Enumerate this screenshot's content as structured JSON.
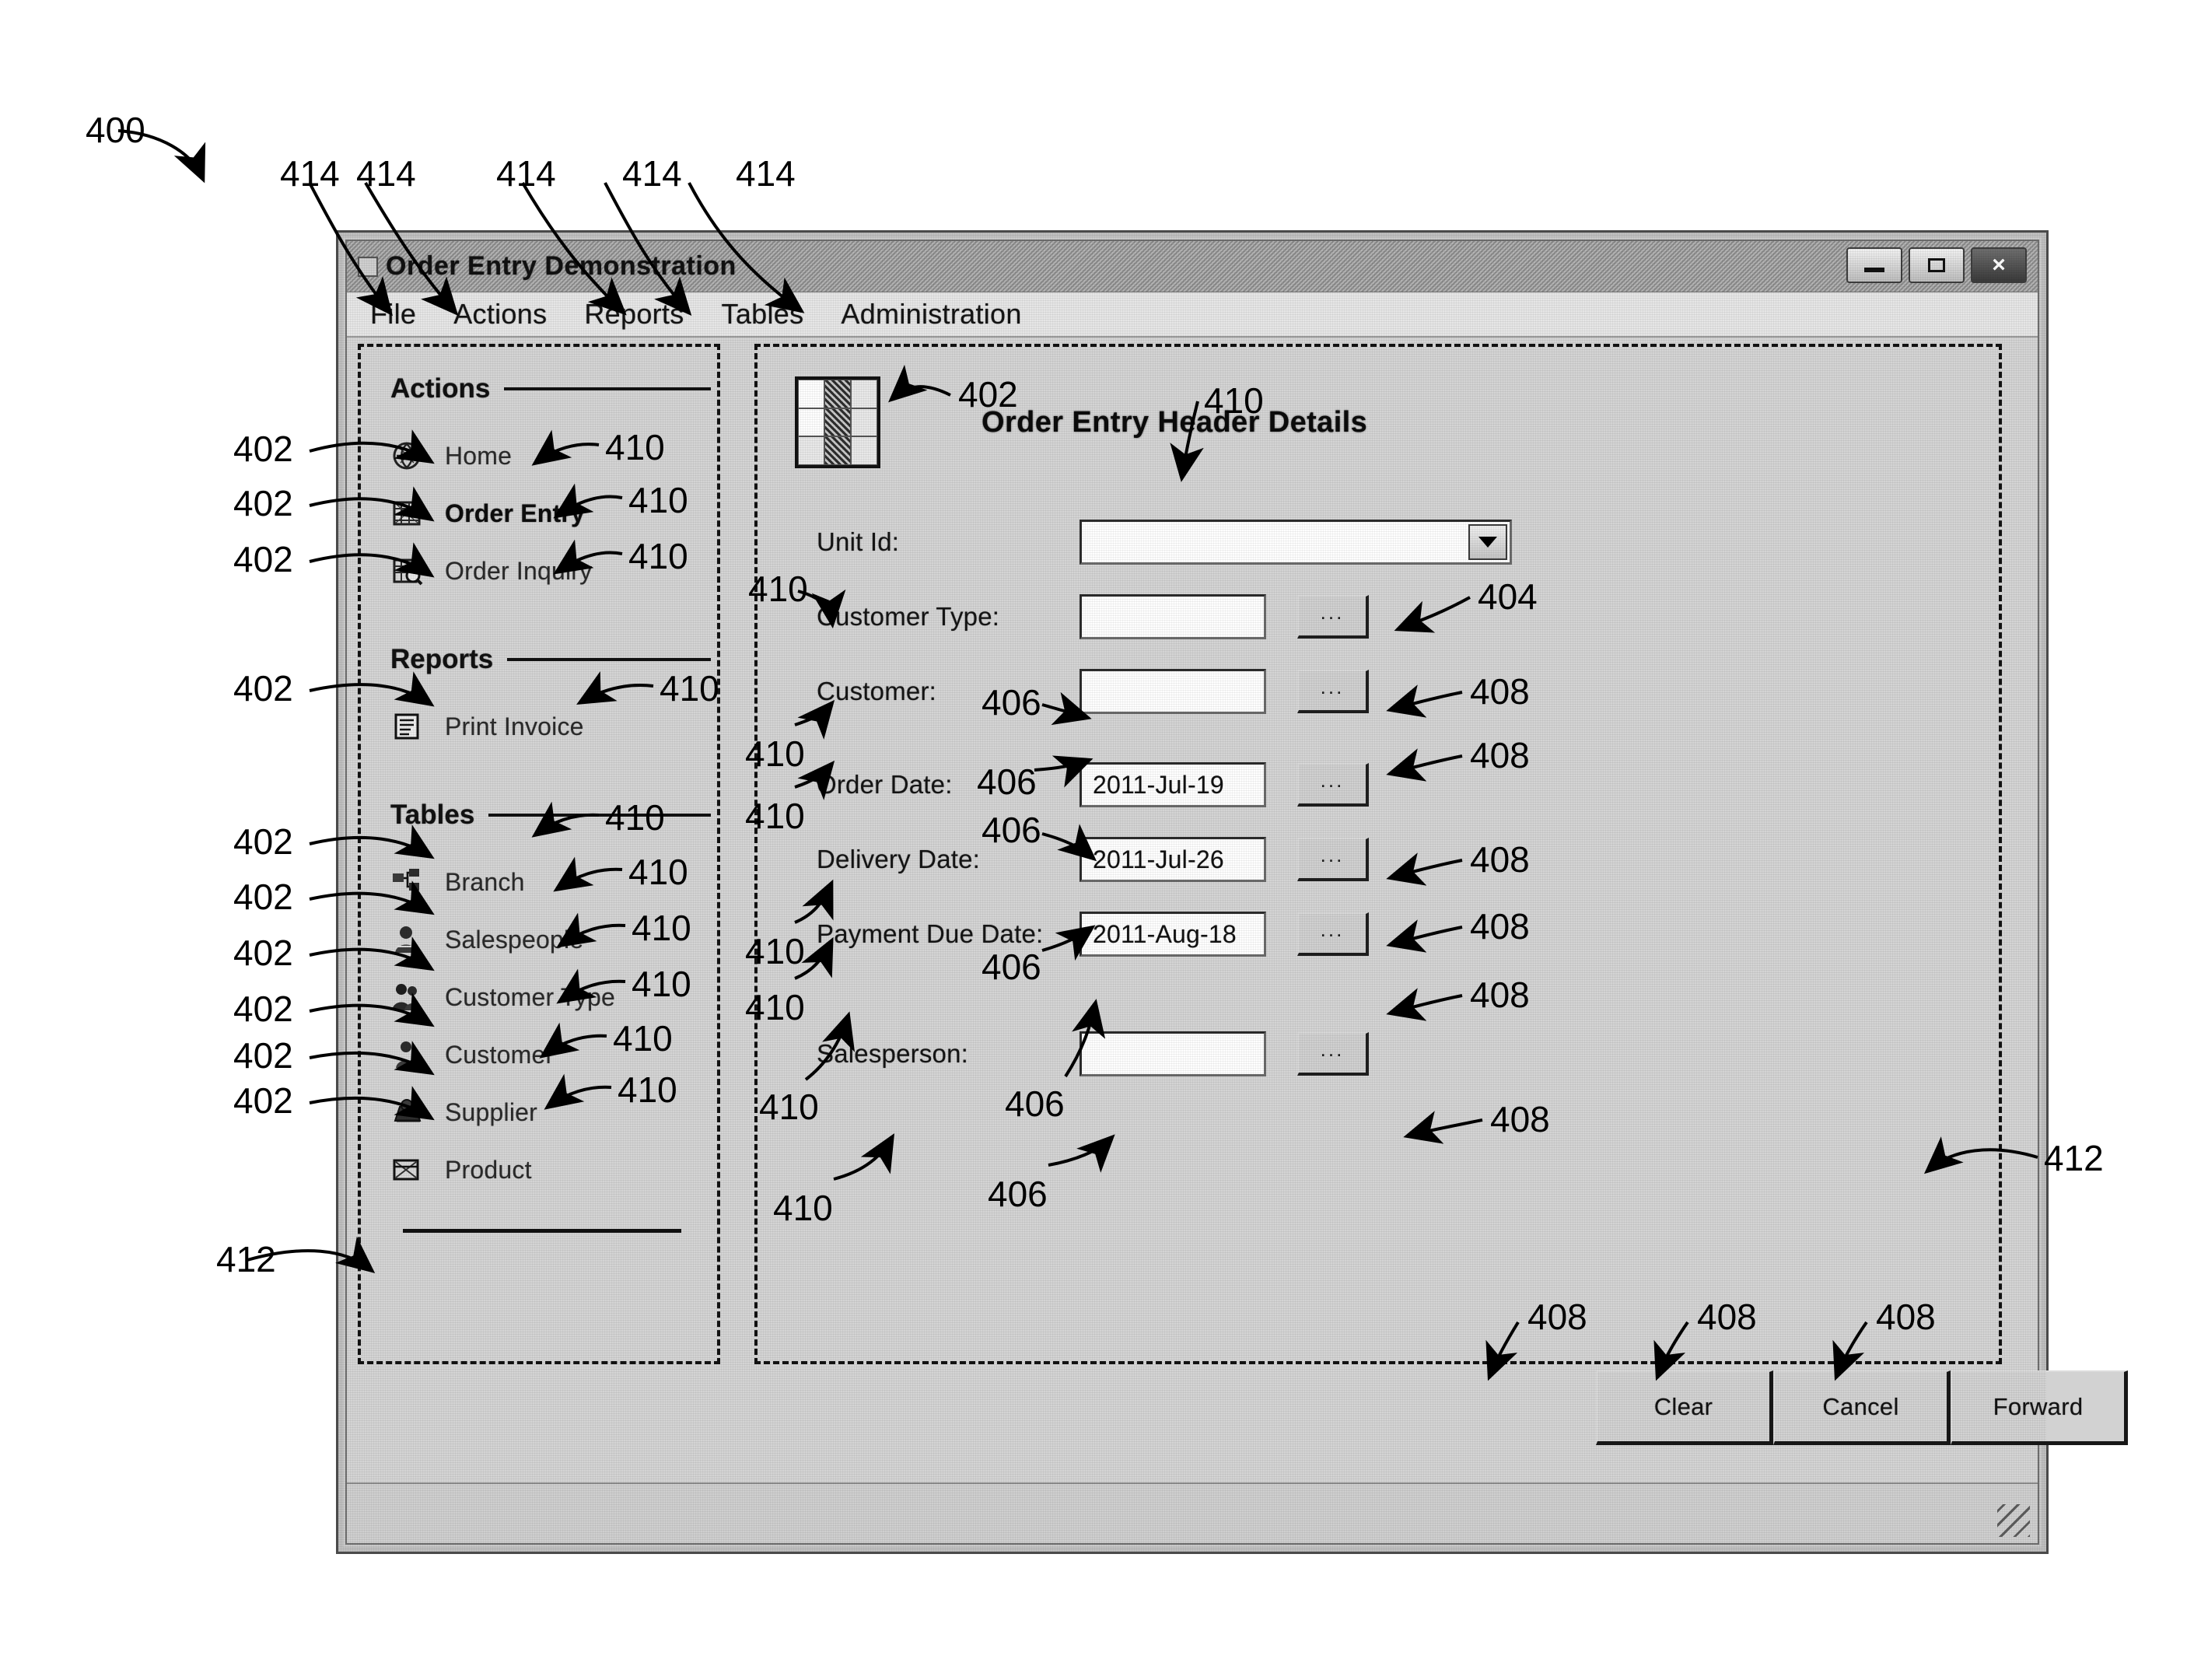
{
  "figure": {
    "number": "400",
    "callouts": {
      "menu_items": "414",
      "nav_item": "402",
      "label": "410",
      "combo": "404",
      "textbox": "406",
      "button": "408",
      "region": "412"
    }
  },
  "window": {
    "title": "Order Entry Demonstration",
    "app_icon": "app-icon",
    "controls": {
      "minimize": "minimize",
      "maximize": "maximize",
      "close": "×"
    }
  },
  "menubar": {
    "items": [
      {
        "label": "File"
      },
      {
        "label": "Actions"
      },
      {
        "label": "Reports"
      },
      {
        "label": "Tables"
      },
      {
        "label": "Administration"
      }
    ]
  },
  "sidebar": {
    "groups": [
      {
        "title": "Actions",
        "items": [
          {
            "label": "Home",
            "icon": "home-icon",
            "bold": false
          },
          {
            "label": "Order Entry",
            "icon": "order-entry-icon",
            "bold": true
          },
          {
            "label": "Order Inquiry",
            "icon": "order-inquiry-icon",
            "bold": false
          }
        ]
      },
      {
        "title": "Reports",
        "items": [
          {
            "label": "Print Invoice",
            "icon": "print-invoice-icon",
            "bold": false
          }
        ]
      },
      {
        "title": "Tables",
        "items": [
          {
            "label": "Branch",
            "icon": "branch-icon",
            "bold": false
          },
          {
            "label": "Salespeople",
            "icon": "salespeople-icon",
            "bold": false
          },
          {
            "label": "Customer Type",
            "icon": "customer-type-icon",
            "bold": false
          },
          {
            "label": "Customer",
            "icon": "customer-icon",
            "bold": false
          },
          {
            "label": "Supplier",
            "icon": "supplier-icon",
            "bold": false
          },
          {
            "label": "Product",
            "icon": "product-icon",
            "bold": false
          }
        ]
      }
    ]
  },
  "main": {
    "panel_icon": "grid-table-icon",
    "title": "Order Entry Header Details",
    "fields": [
      {
        "label": "Unit Id:",
        "value": "",
        "control": "combo",
        "has_ellipsis": false
      },
      {
        "label": "Customer Type:",
        "value": "",
        "control": "textbox",
        "has_ellipsis": true
      },
      {
        "label": "Customer:",
        "value": "",
        "control": "textbox",
        "has_ellipsis": true
      },
      {
        "label": "Order Date:",
        "value": "2011-Jul-19",
        "control": "textbox",
        "has_ellipsis": true
      },
      {
        "label": "Delivery Date:",
        "value": "2011-Jul-26",
        "control": "textbox",
        "has_ellipsis": true
      },
      {
        "label": "Payment Due Date:",
        "value": "2011-Aug-18",
        "control": "textbox",
        "has_ellipsis": true
      },
      {
        "label": "Salesperson:",
        "value": "",
        "control": "textbox",
        "has_ellipsis": true
      }
    ],
    "ellipsis_label": "...",
    "buttons": [
      {
        "label": "Clear"
      },
      {
        "label": "Cancel"
      },
      {
        "label": "Forward"
      }
    ]
  }
}
